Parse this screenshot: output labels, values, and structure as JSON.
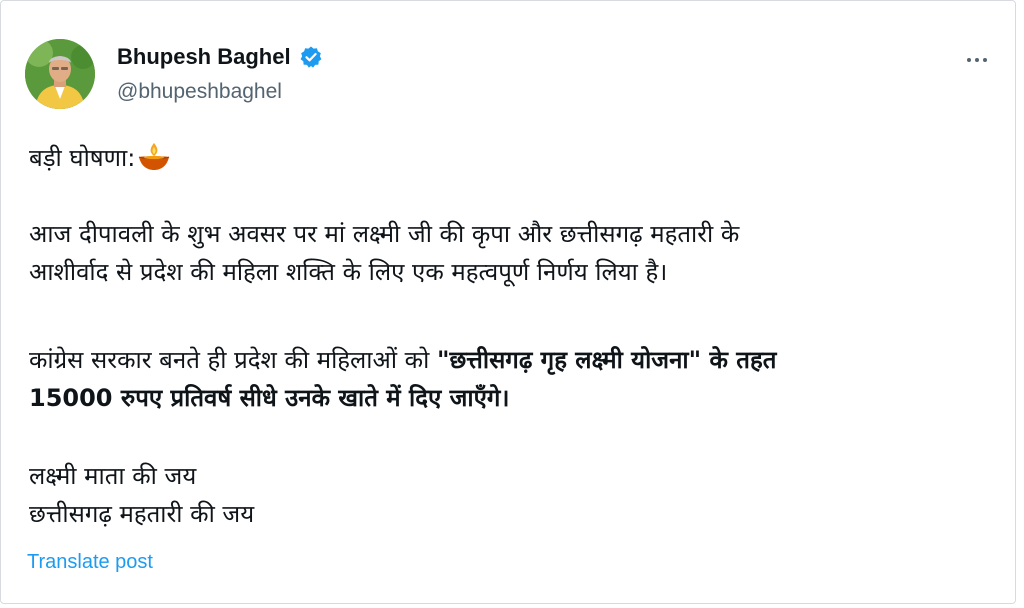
{
  "author": {
    "display_name": "Bhupesh Baghel",
    "handle": "@bhupeshbaghel",
    "avatar_icon": "profile-photo",
    "verified_icon": "verified-badge-icon"
  },
  "menu": {
    "more_icon": "more-horizontal-icon"
  },
  "post": {
    "headline": "बड़ी घोषणा:",
    "headline_emoji_icon": "diya-lamp-icon",
    "para2_line1": "आज दीपावली के शुभ अवसर पर मां लक्ष्मी जी की कृपा और छत्तीसगढ़ महतारी के",
    "para2_line2": "आशीर्वाद से प्रदेश की महिला शक्ति के लिए एक महत्वपूर्ण निर्णय लिया है।",
    "para3_line1_normal": "कांग्रेस सरकार बनते ही प्रदेश की महिलाओं को ",
    "para3_line1_bold": "\"छत्तीसगढ़ गृह लक्ष्मी योजना\" के तहत",
    "para3_line2_bold": "15000 रुपए प्रतिवर्ष सीधे उनके खाते में दिए जाएँगे।",
    "para4_line1": "लक्ष्मी माता की जय",
    "para4_line2": "छत्तीसगढ़ महतारी की जय"
  },
  "actions": {
    "translate_label": "Translate post"
  },
  "colors": {
    "link": "#1d9bf0",
    "secondary_text": "#536471",
    "verified": "#1d9bf0"
  }
}
